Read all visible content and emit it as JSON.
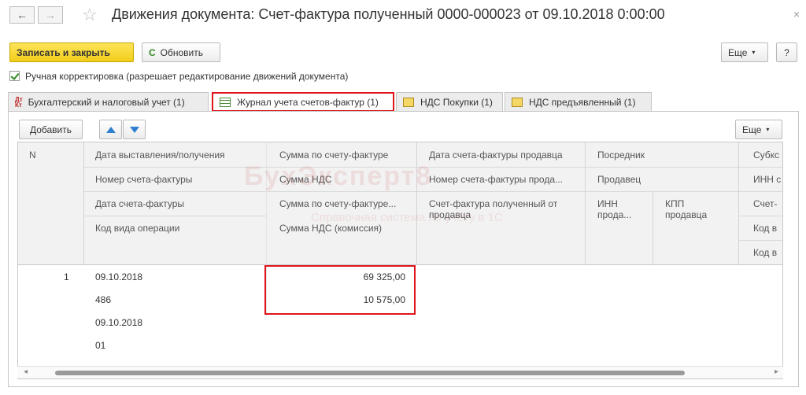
{
  "window": {
    "title": "Движения документа: Счет-фактура полученный 0000-000023 от 09.10.2018 0:00:00",
    "back_glyph": "←",
    "forward_glyph": "→",
    "star_glyph": "☆",
    "close_glyph": "×"
  },
  "toolbar": {
    "save_close_label": "Записать и закрыть",
    "refresh_label": "Обновить",
    "more_label": "Еще",
    "help_label": "?"
  },
  "manual_correction": {
    "label": "Ручная корректировка (разрешает редактирование движений документа)",
    "checked": true
  },
  "tabs": [
    {
      "label": "Бухгалтерский и налоговый учет (1)",
      "icon": "dt-kt-icon"
    },
    {
      "label": "Журнал учета счетов-фактур (1)",
      "icon": "table-grid-icon",
      "active": true
    },
    {
      "label": "НДС Покупки (1)",
      "icon": "register-icon"
    },
    {
      "label": "НДС предъявленный (1)",
      "icon": "register-icon"
    }
  ],
  "table_toolbar": {
    "add_label": "Добавить",
    "more_label": "Еще",
    "up_glyph": "🡅",
    "down_glyph": "🡇"
  },
  "columns": {
    "n": "N",
    "c1": [
      "Дата выставления/получения",
      "Номер счета-фактуры",
      "Дата счета-фактуры",
      "Код вида операции"
    ],
    "c2": [
      "Сумма по счету-фактуре",
      "Сумма НДС",
      "Сумма по счету-фактуре...",
      "Сумма НДС (комиссия)"
    ],
    "c3": [
      "Дата счета-фактуры продавца",
      "Номер счета-фактуры прода...",
      "Счет-фактура полученный от",
      "продавца"
    ],
    "c4": [
      "Посредник",
      "Продавец",
      "ИНН",
      "прода...",
      "КПП",
      "продавца"
    ],
    "c5": [
      "Субкс",
      "ИНН с",
      "Счет-",
      "Код в",
      "Код в"
    ]
  },
  "rows": [
    {
      "n": "1",
      "c1": [
        "09.10.2018",
        "486",
        "09.10.2018",
        "01"
      ],
      "c2": [
        "69 325,00",
        "10 575,00"
      ]
    }
  ],
  "watermark": {
    "brand": "БухЭксперт8",
    "tagline": "Справочная система по учёту в 1С"
  },
  "scroll": {
    "left_glyph": "◂",
    "right_glyph": "▸"
  }
}
